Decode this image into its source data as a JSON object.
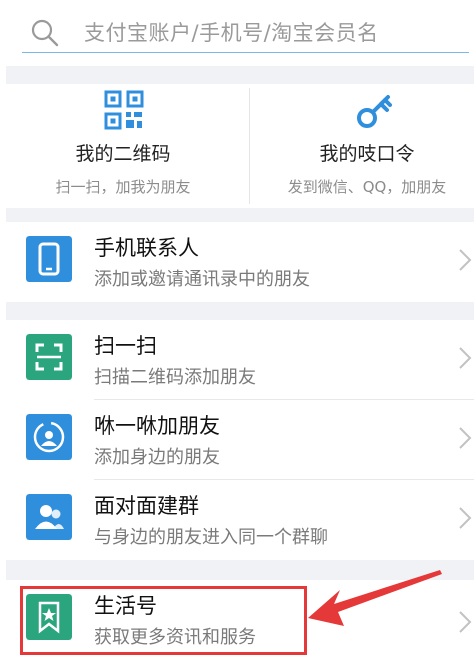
{
  "search": {
    "placeholder": "支付宝账户/手机号/淘宝会员名"
  },
  "quick": [
    {
      "title": "我的二维码",
      "subtitle": "扫一扫，加我为朋友",
      "icon": "qrcode-icon"
    },
    {
      "title": "我的吱口令",
      "subtitle": "发到微信、QQ，加朋友",
      "icon": "key-icon"
    }
  ],
  "items": [
    {
      "title": "手机联系人",
      "subtitle": "添加或邀请通讯录中的朋友",
      "icon": "phone-icon",
      "color": "#2f8fdc"
    },
    {
      "title": "扫一扫",
      "subtitle": "扫描二维码添加朋友",
      "icon": "scan-icon",
      "color": "#2aa57d"
    },
    {
      "title": "咻一咻加朋友",
      "subtitle": "添加身边的朋友",
      "icon": "radar-icon",
      "color": "#2f8fdc"
    },
    {
      "title": "面对面建群",
      "subtitle": "与身边的朋友进入同一个群聊",
      "icon": "group-icon",
      "color": "#2f8fdc"
    },
    {
      "title": "生活号",
      "subtitle": "获取更多资讯和服务",
      "icon": "bookmark-star-icon",
      "color": "#2aa57d"
    }
  ],
  "colors": {
    "accent_blue": "#2f8fdc",
    "accent_green": "#2aa57d",
    "annotation_red": "#e53838"
  }
}
